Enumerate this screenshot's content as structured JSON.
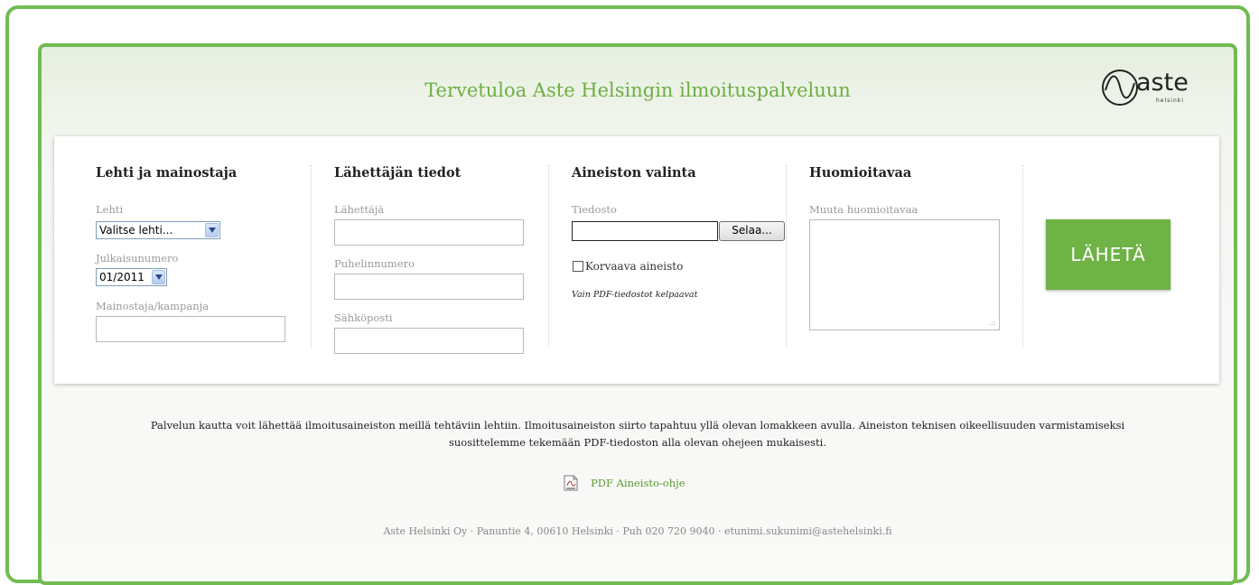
{
  "header": {
    "title": "Tervetuloa Aste Helsingin ilmoituspalveluun"
  },
  "logo": {
    "word": "aste",
    "sub": "helsinki"
  },
  "sections": {
    "lehti": {
      "title": "Lehti ja mainostaja",
      "lehti_label": "Lehti",
      "lehti_value": "Valitse lehti...",
      "julkaisu_label": "Julkaisunumero",
      "julkaisu_value": "01/2011",
      "mainostaja_label": "Mainostaja/kampanja"
    },
    "lahettaja": {
      "title": "Lähettäjän tiedot",
      "lahettaja_label": "Lähettäjä",
      "puhelin_label": "Puhelinnumero",
      "sahkoposti_label": "Sähköposti"
    },
    "aineisto": {
      "title": "Aineiston valinta",
      "tiedosto_label": "Tiedosto",
      "browse_label": "Selaa...",
      "checkbox_label": "Korvaava aineisto",
      "note": "Vain PDF-tiedostot kelpaavat"
    },
    "huomio": {
      "title": "Huomioitavaa",
      "muuta_label": "Muuta huomioitavaa"
    }
  },
  "submit_label": "LÄHETÄ",
  "info": {
    "line1": "Palvelun kautta voit lähettää ilmoitusaineiston meillä tehtäviin lehtiin. Ilmoitusaineiston siirto tapahtuu yllä olevan lomakkeen avulla. Aineiston teknisen oikeellisuuden varmistamiseksi",
    "line2": "suosittelemme tekemään PDF-tiedoston alla olevan ohejeen mukaisesti."
  },
  "pdf_link": "PDF Aineisto-ohje",
  "footer": "Aste Helsinki Oy · Panuntie 4, 00610 Helsinki · Puh 020 720 9040 · etunimi.sukunimi@astehelsinki.fi",
  "colors": {
    "accent": "#6fb245",
    "title": "#6fae44"
  }
}
